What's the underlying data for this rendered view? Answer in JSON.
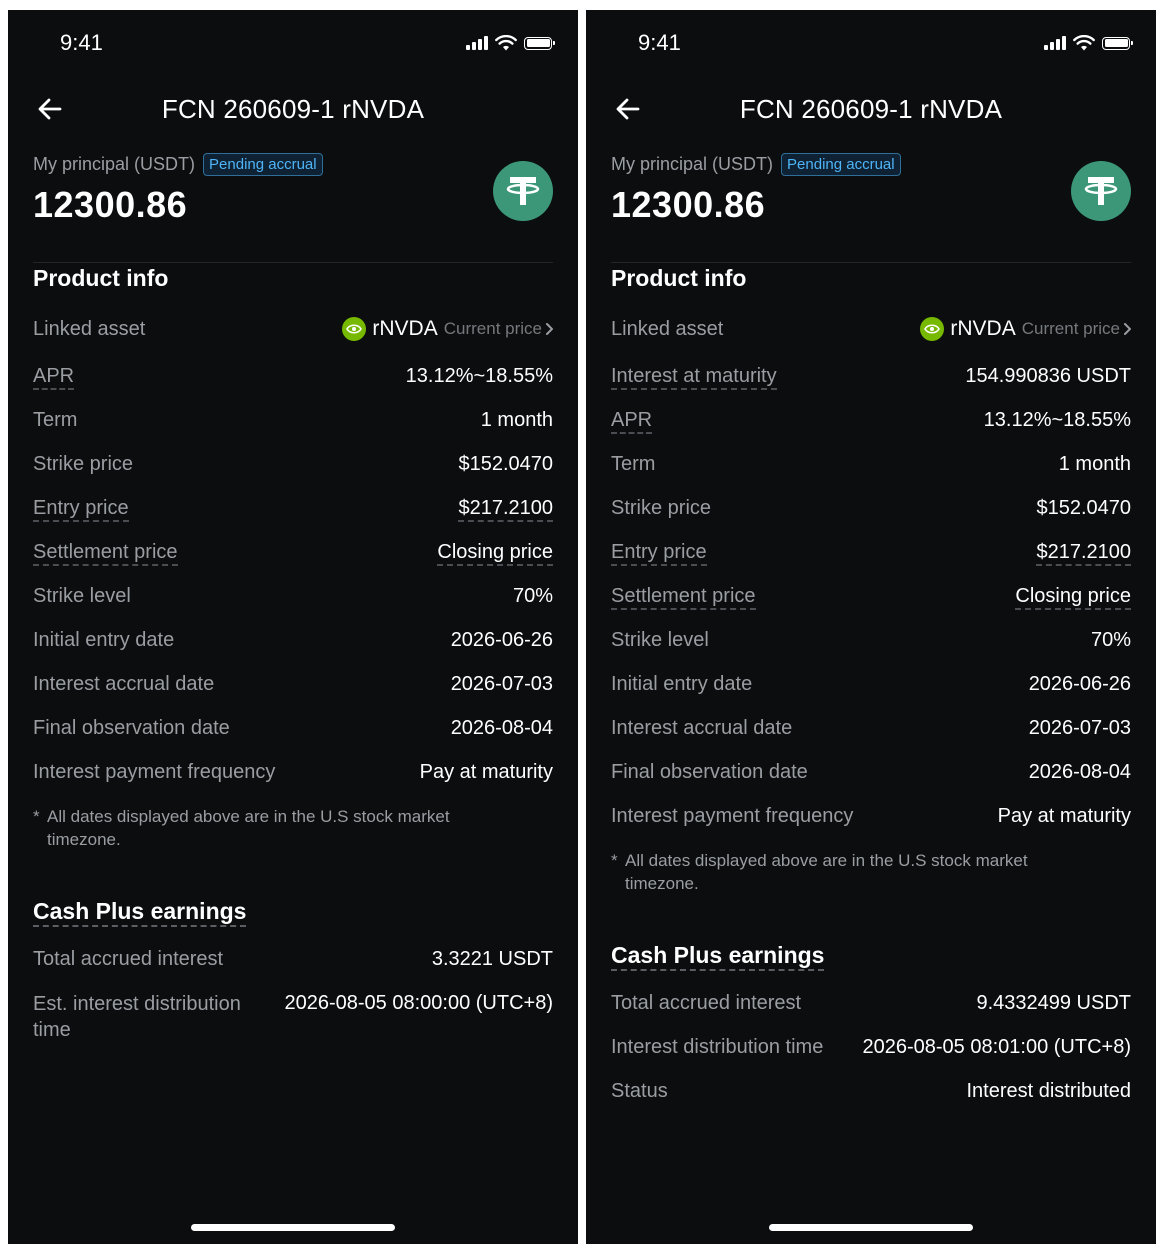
{
  "left": {
    "status": {
      "time": "9:41"
    },
    "nav": {
      "title": "FCN 260609-1 rNVDA"
    },
    "principal": {
      "label": "My principal (USDT)",
      "badge": "Pending accrual",
      "value": "12300.86"
    },
    "product_info_title": "Product info",
    "linked_asset": {
      "label": "Linked asset",
      "name": "rNVDA",
      "link": "Current price"
    },
    "rows": [
      {
        "label": "APR",
        "value": "13.12%~18.55%"
      },
      {
        "label": "Term",
        "value": "1 month"
      },
      {
        "label": "Strike price",
        "value": "$152.0470"
      },
      {
        "label": "Entry price",
        "value": "$217.2100"
      },
      {
        "label": "Settlement price",
        "value": "Closing price"
      },
      {
        "label": "Strike level",
        "value": "70%"
      },
      {
        "label": "Initial entry date",
        "value": "2026-06-26"
      },
      {
        "label": "Interest accrual date",
        "value": "2026-07-03"
      },
      {
        "label": "Final observation date",
        "value": "2026-08-04"
      },
      {
        "label": "Interest payment frequency",
        "value": "Pay at maturity"
      }
    ],
    "note_star": "*",
    "note": "All dates displayed above are in the U.S stock market timezone.",
    "cash_plus_title": "Cash Plus earnings",
    "cash_rows": [
      {
        "label": "Total accrued interest",
        "value": "3.3221 USDT"
      },
      {
        "label": "Est. interest distribution time",
        "value": "2026-08-05 08:00:00 (UTC+8)"
      }
    ]
  },
  "right": {
    "status": {
      "time": "9:41"
    },
    "nav": {
      "title": "FCN 260609-1 rNVDA"
    },
    "principal": {
      "label": "My principal (USDT)",
      "badge": "Pending accrual",
      "value": "12300.86"
    },
    "product_info_title": "Product info",
    "linked_asset": {
      "label": "Linked asset",
      "name": "rNVDA",
      "link": "Current price"
    },
    "rows": [
      {
        "label": "Interest at maturity",
        "value": "154.990836 USDT"
      },
      {
        "label": "APR",
        "value": "13.12%~18.55%"
      },
      {
        "label": "Term",
        "value": "1 month"
      },
      {
        "label": "Strike price",
        "value": "$152.0470"
      },
      {
        "label": "Entry price",
        "value": "$217.2100"
      },
      {
        "label": "Settlement price",
        "value": "Closing price"
      },
      {
        "label": "Strike level",
        "value": "70%"
      },
      {
        "label": "Initial entry date",
        "value": "2026-06-26"
      },
      {
        "label": "Interest accrual date",
        "value": "2026-07-03"
      },
      {
        "label": "Final observation date",
        "value": "2026-08-04"
      },
      {
        "label": "Interest payment frequency",
        "value": "Pay at maturity"
      }
    ],
    "note_star": "*",
    "note": "All dates displayed above are in the U.S stock market timezone.",
    "cash_plus_title": "Cash Plus earnings",
    "cash_rows": [
      {
        "label": "Total accrued interest",
        "value": "9.4332499 USDT"
      },
      {
        "label": "Interest distribution time",
        "value": "2026-08-05 08:01:00 (UTC+8)"
      },
      {
        "label": "Status",
        "value": "Interest distributed"
      }
    ]
  },
  "colors": {
    "background": "#0b0d0e",
    "usdt_green": "#3b9778",
    "nvidia_green": "#76b900",
    "badge_blue": "#4fb3f7"
  }
}
